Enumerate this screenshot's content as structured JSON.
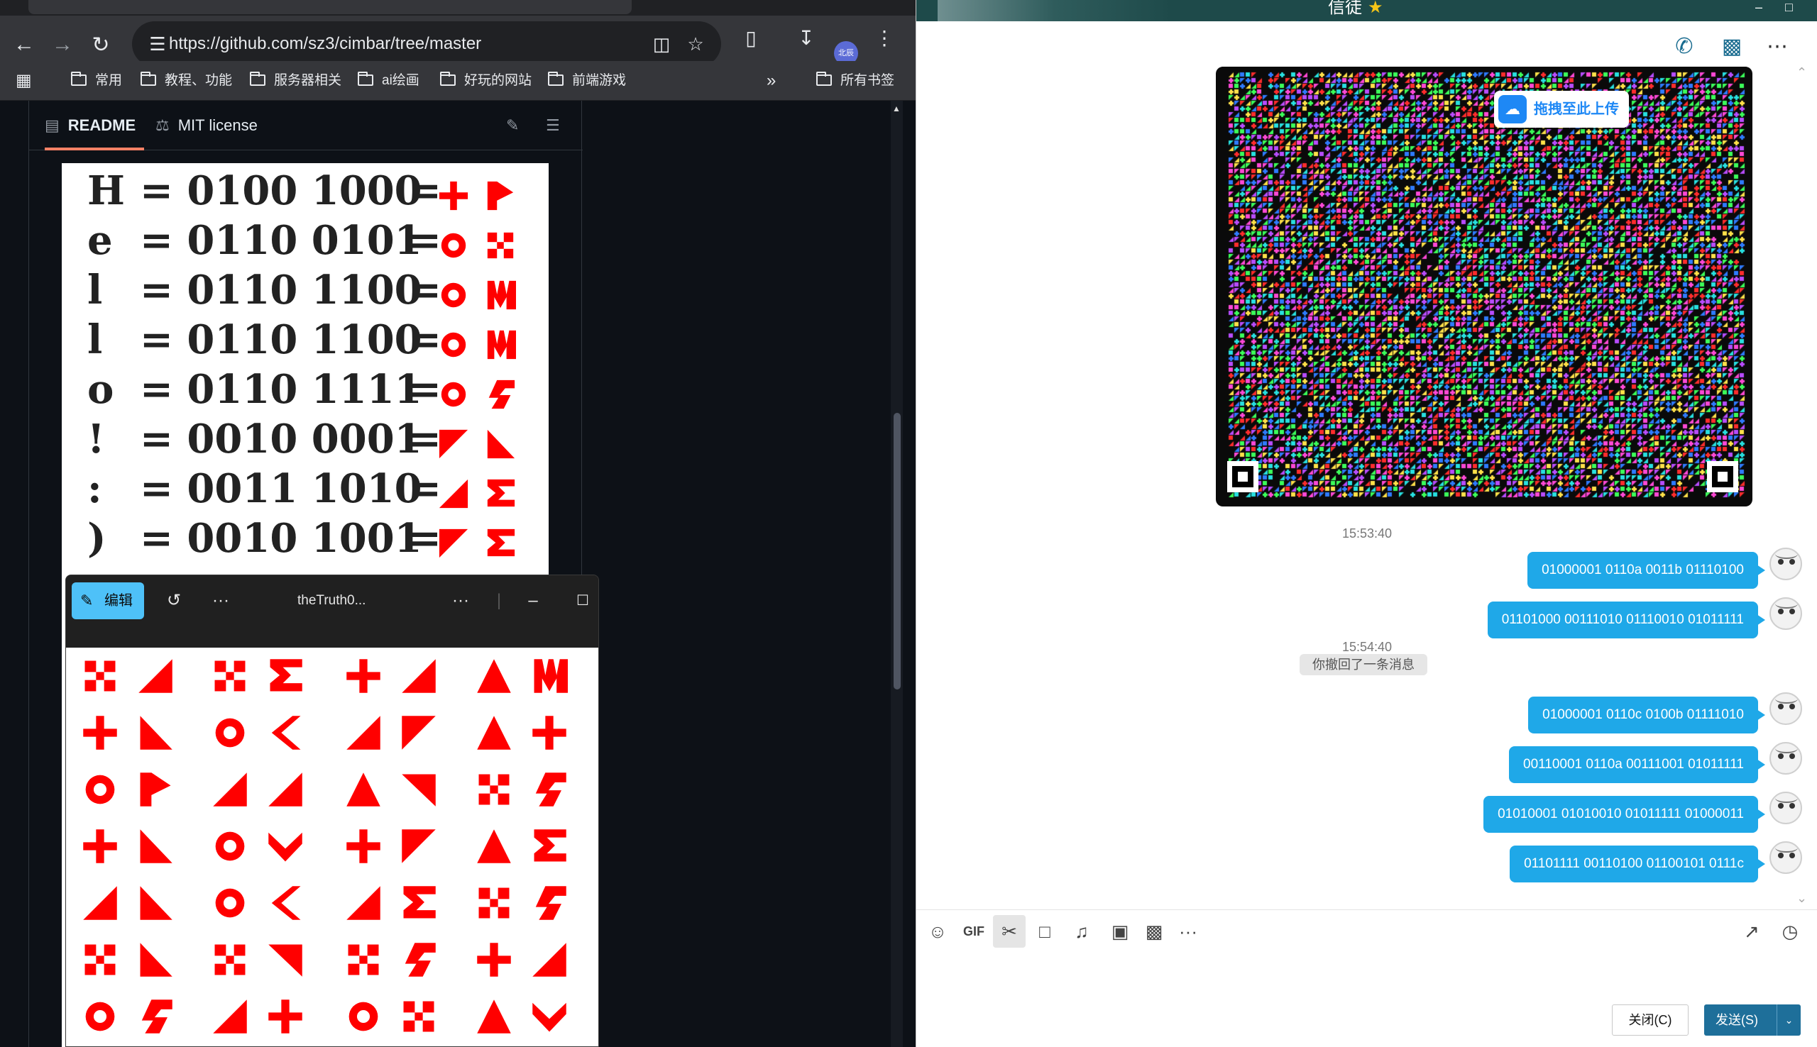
{
  "browser": {
    "url": "https://github.com/sz3/cimbar/tree/master",
    "profile_initials": "北辰",
    "bookmarks": [
      "常用",
      "教程、功能",
      "服务器相关",
      "ai绘画",
      "好玩的网站",
      "前端游戏"
    ],
    "bookmarks_overflow": "»",
    "all_bookmarks": "所有书签",
    "readme_tabs": {
      "readme": "README",
      "license": "MIT license"
    },
    "encoding_rows": [
      {
        "char": "H",
        "bits": "= 0100 1000",
        "eq": "="
      },
      {
        "char": "e",
        "bits": "= 0110 0101",
        "eq": "="
      },
      {
        "char": "l",
        "bits": "= 0110 1100",
        "eq": "="
      },
      {
        "char": "l",
        "bits": "= 0110 1100",
        "eq": "="
      },
      {
        "char": "o",
        "bits": "= 0110 1111",
        "eq": "="
      },
      {
        "char": "!",
        "bits": "= 0010 0001",
        "eq": "="
      },
      {
        "char": ":",
        "bits": "= 0011 1010",
        "eq": "="
      },
      {
        "char": ")",
        "bits": "= 0010 1001",
        "eq": "="
      }
    ],
    "symbol_color": "#ff0000"
  },
  "viewer": {
    "edit_label": "编辑",
    "title": "theTruth0...",
    "more_label": "···",
    "menu_label": "···"
  },
  "chat": {
    "title": "信徒",
    "upload_overlay": "拖拽至此上传",
    "messages": [
      {
        "type": "time",
        "text": "15:53:40"
      },
      {
        "type": "bubble",
        "text": "01000001 0110a 0011b 01110100"
      },
      {
        "type": "bubble",
        "text": "01101000 00111010 01110010 01011111"
      },
      {
        "type": "time",
        "text": "15:54:40"
      },
      {
        "type": "recall",
        "text": "你撤回了一条消息"
      },
      {
        "type": "bubble",
        "text": "01000001 0110c 0100b 01111010"
      },
      {
        "type": "bubble",
        "text": "00110001 0110a 00111001 01011111"
      },
      {
        "type": "bubble",
        "text": "01010001 01010010 01011111 01000011"
      },
      {
        "type": "bubble",
        "text": "01101111 00110100 01100101 0111c"
      }
    ],
    "toolbar_labels": {
      "gif": "GIF",
      "more": "···"
    },
    "close_button": "关闭(C)",
    "send_button": "发送(S)",
    "accent": "#1fa8e8"
  }
}
